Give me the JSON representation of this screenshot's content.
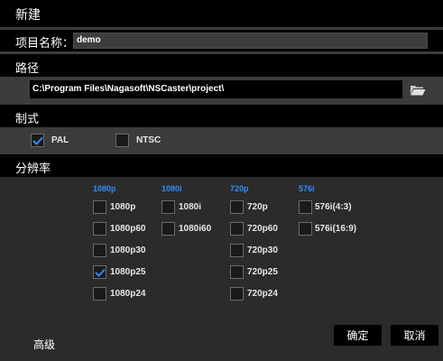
{
  "dialog": {
    "title": "新建"
  },
  "project": {
    "label": "项目名称：",
    "value": "demo"
  },
  "path": {
    "section_label": "路径",
    "value": "C:\\Program Files\\Nagasoft\\NSCaster\\project\\",
    "folder_icon": "folder-icon"
  },
  "format": {
    "section_label": "制式",
    "options": [
      {
        "label": "PAL",
        "checked": true
      },
      {
        "label": "NTSC",
        "checked": false
      }
    ]
  },
  "resolution": {
    "section_label": "分辨率",
    "columns": [
      {
        "header": "1080p",
        "items": [
          {
            "label": "1080p",
            "checked": false
          },
          {
            "label": "1080p60",
            "checked": false
          },
          {
            "label": "1080p30",
            "checked": false
          },
          {
            "label": "1080p25",
            "checked": true
          },
          {
            "label": "1080p24",
            "checked": false
          }
        ]
      },
      {
        "header": "1080i",
        "items": [
          {
            "label": "1080i",
            "checked": false
          },
          {
            "label": "1080i60",
            "checked": false
          }
        ]
      },
      {
        "header": "720p",
        "items": [
          {
            "label": "720p",
            "checked": false
          },
          {
            "label": "720p60",
            "checked": false
          },
          {
            "label": "720p30",
            "checked": false
          },
          {
            "label": "720p25",
            "checked": false
          },
          {
            "label": "720p24",
            "checked": false
          }
        ]
      },
      {
        "header": "576i",
        "items": [
          {
            "label": "576i(4:3)",
            "checked": false
          },
          {
            "label": "576i(16:9)",
            "checked": false
          }
        ]
      }
    ]
  },
  "footer": {
    "advanced_label": "高级",
    "ok_label": "确定",
    "cancel_label": "取消"
  },
  "colors": {
    "accent": "#2f8cff",
    "header_bg": "#000000",
    "panel_bg": "#3c3c3c",
    "res_bg": "#2b2b2b"
  }
}
